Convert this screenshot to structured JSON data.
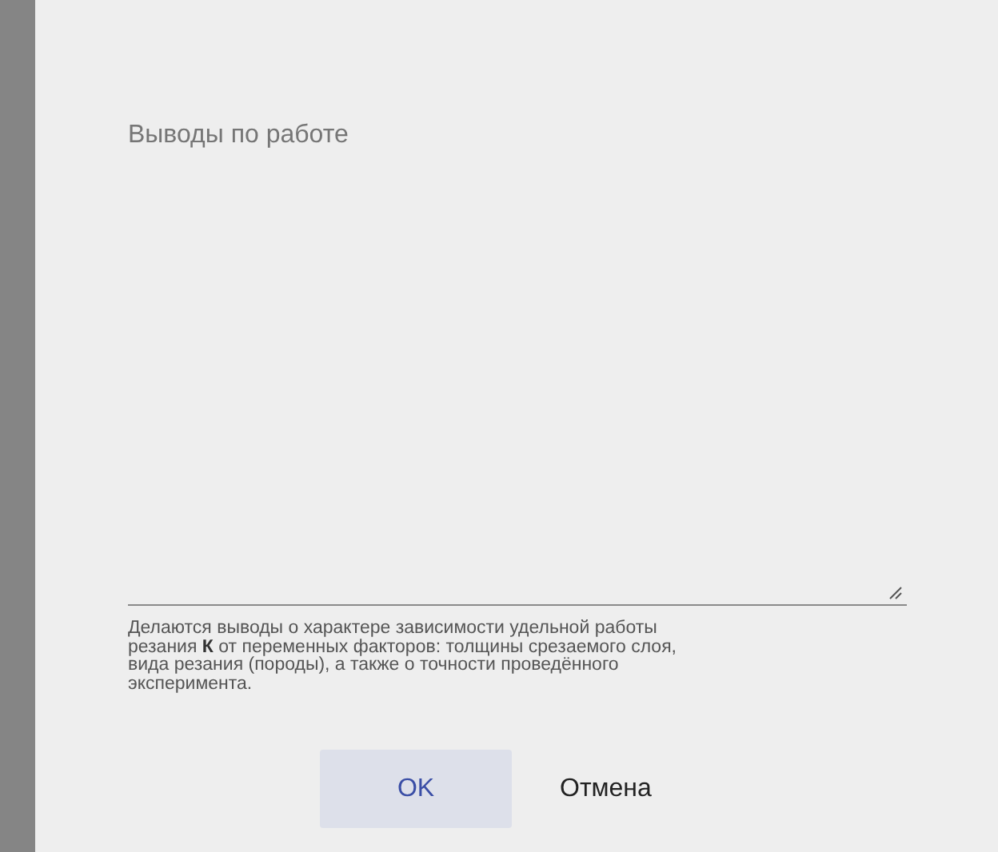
{
  "dialog": {
    "field": {
      "label": "Выводы по работе"
    },
    "hint": "Делаются выводы о характере зависимости удельной работы резания **К** от переменных факторов: толщины срезаемого слоя, вида резания (породы), а также о точности проведённого эксперимента.",
    "buttons": [
      {
        "label": "OK",
        "kind": "primary"
      },
      {
        "label": "Отмена",
        "kind": "flat"
      }
    ]
  }
}
